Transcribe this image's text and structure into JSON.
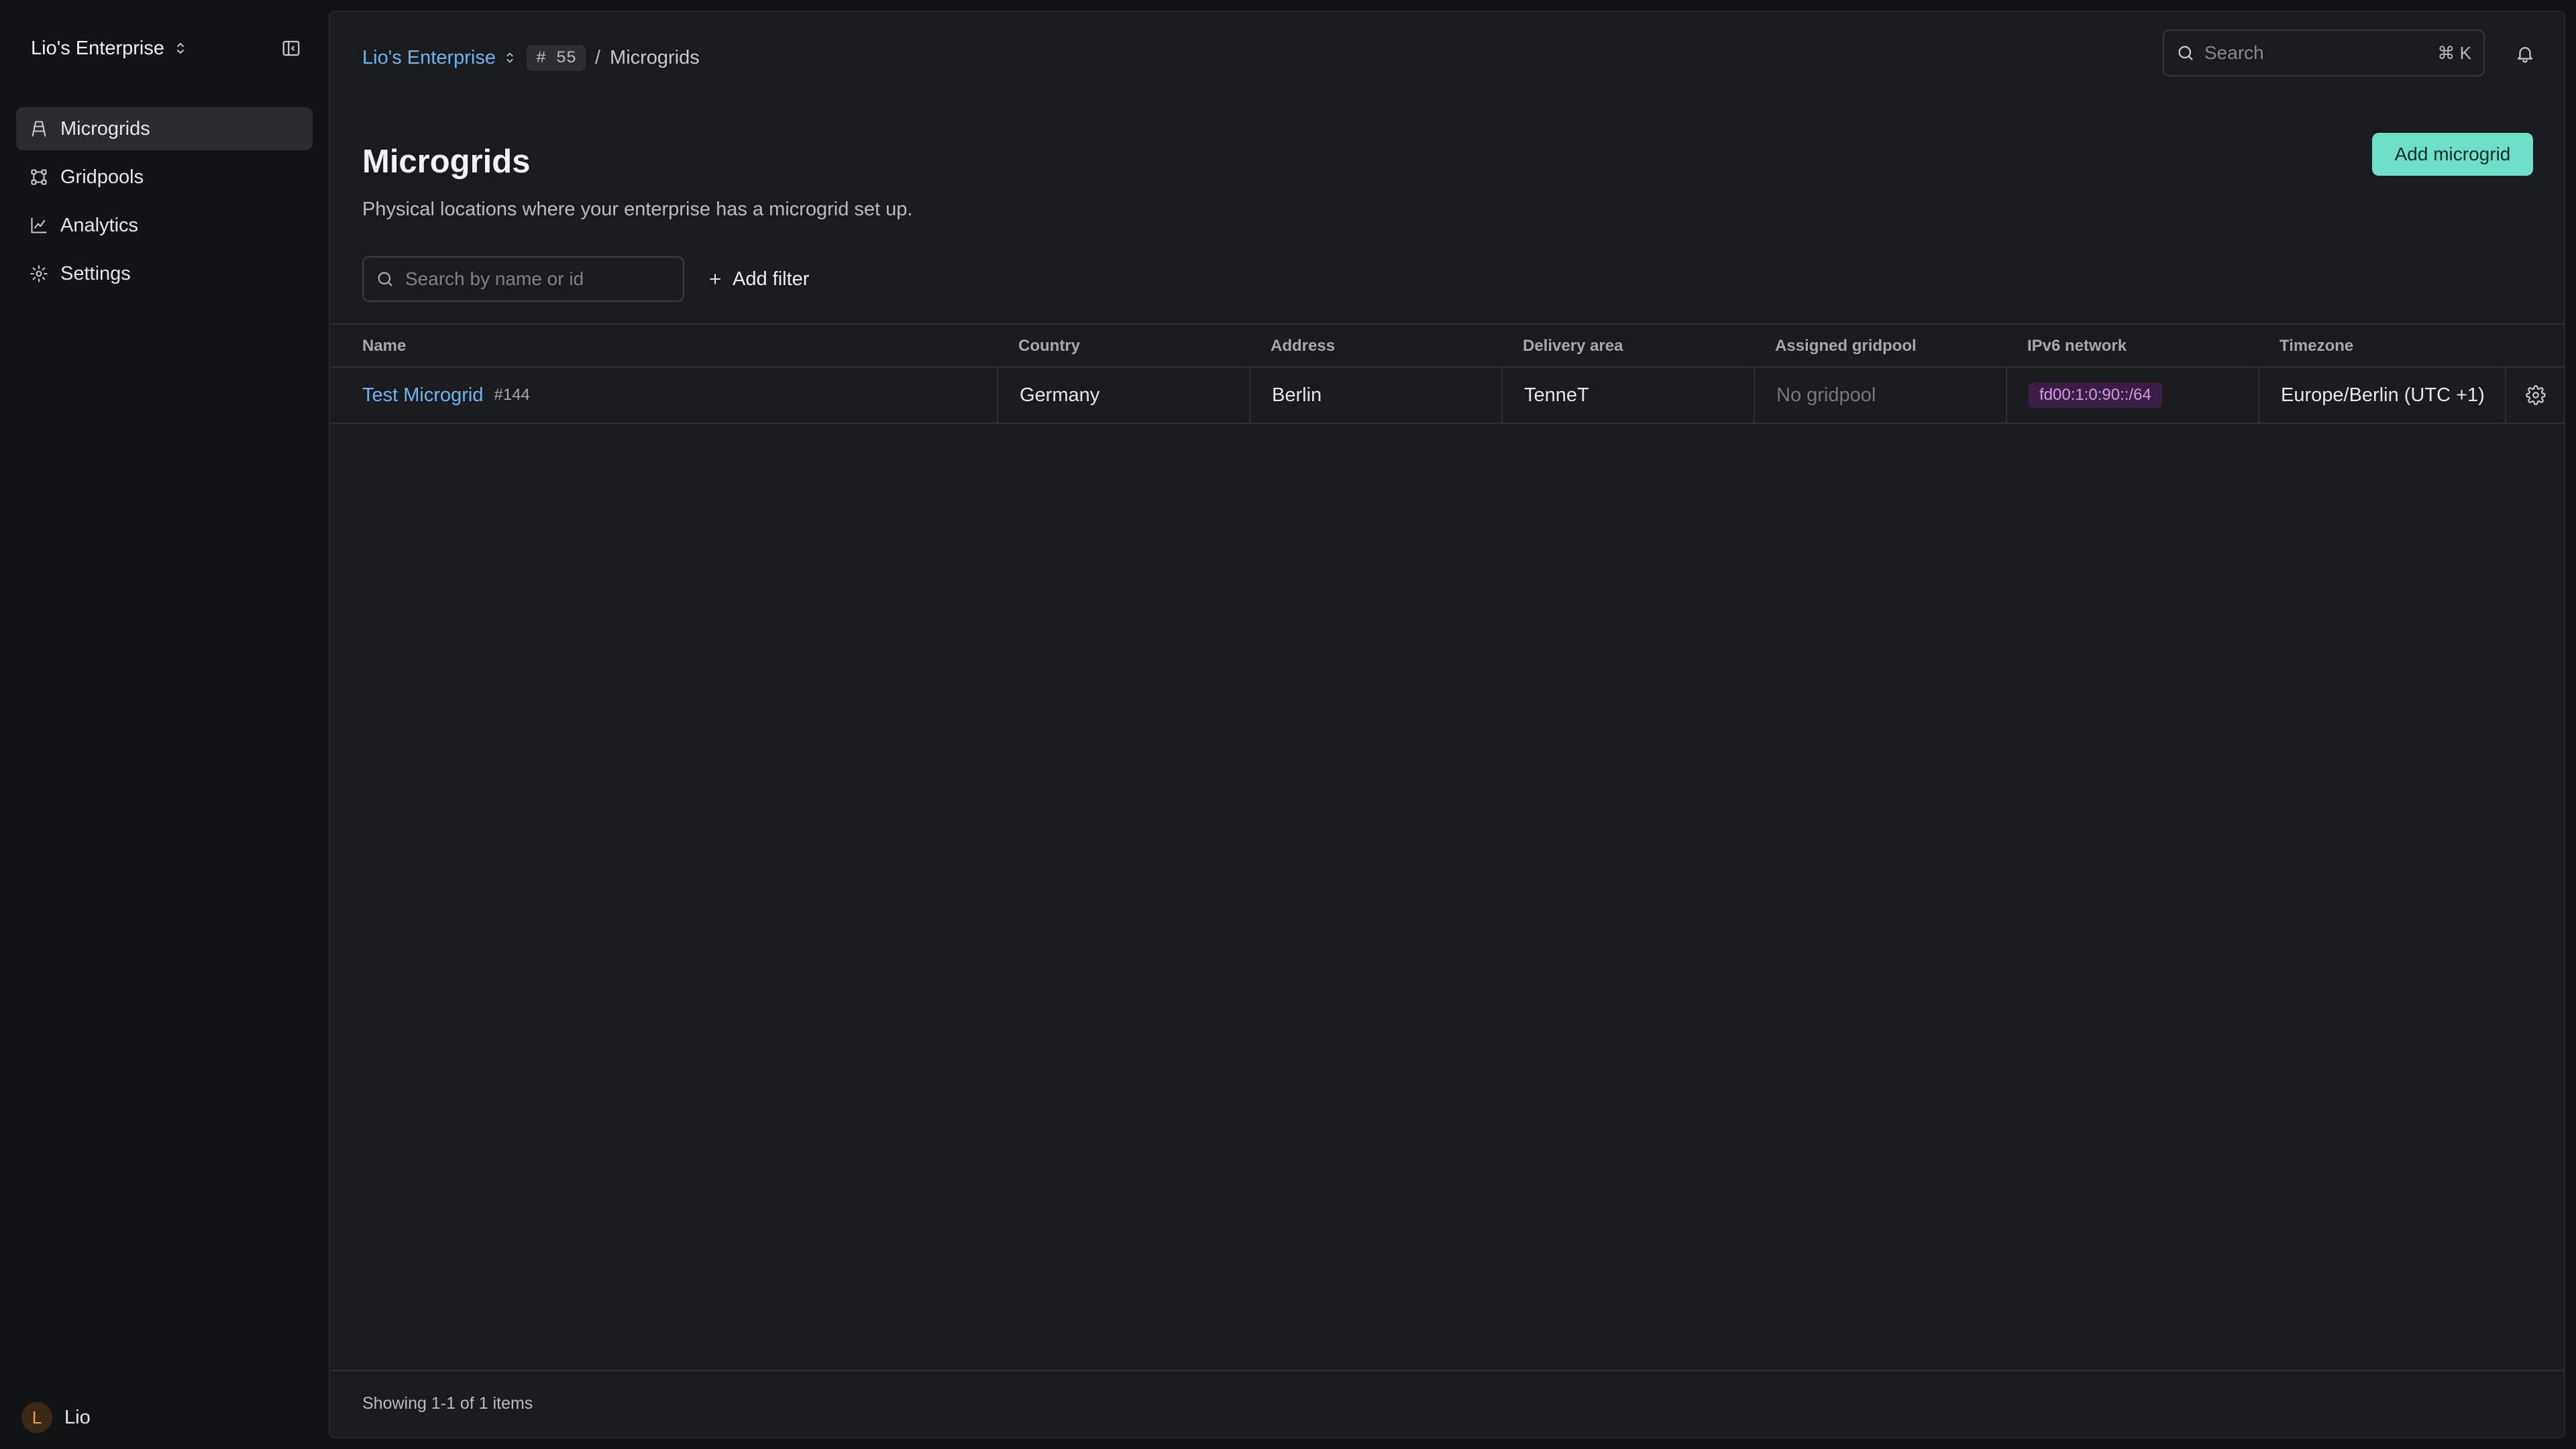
{
  "sidebar": {
    "enterprise_name": "Lio's Enterprise",
    "items": [
      {
        "label": "Microgrids",
        "icon": "microgrid-icon",
        "active": true
      },
      {
        "label": "Gridpools",
        "icon": "gridpool-icon",
        "active": false
      },
      {
        "label": "Analytics",
        "icon": "chart-icon",
        "active": false
      },
      {
        "label": "Settings",
        "icon": "gear-icon",
        "active": false
      }
    ],
    "user": {
      "initial": "L",
      "name": "Lio"
    }
  },
  "header": {
    "breadcrumb": {
      "enterprise": "Lio's Enterprise",
      "id_badge": "# 55",
      "separator": "/",
      "current": "Microgrids"
    },
    "search": {
      "placeholder": "Search",
      "shortcut": "⌘ K"
    }
  },
  "page": {
    "title": "Microgrids",
    "subtitle": "Physical locations where your enterprise has a microgrid set up.",
    "add_button": "Add microgrid",
    "filter_search_placeholder": "Search by name or id",
    "add_filter": "Add filter"
  },
  "table": {
    "columns": [
      "Name",
      "Country",
      "Address",
      "Delivery area",
      "Assigned gridpool",
      "IPv6 network",
      "Timezone"
    ],
    "rows": [
      {
        "name": "Test Microgrid",
        "id": "#144",
        "country": "Germany",
        "address": "Berlin",
        "delivery_area": "TenneT",
        "gridpool": "No gridpool",
        "ipv6": "fd00:1:0:90::/64",
        "timezone": "Europe/Berlin (UTC +1)"
      }
    ]
  },
  "footer": {
    "showing": "Showing 1-1 of 1 items"
  },
  "colors": {
    "accent": "#6ee0c8",
    "link": "#6fb3f5",
    "ipv6_badge_bg": "#3a1f45",
    "ipv6_badge_text": "#d49ae6",
    "background": "#121314",
    "panel": "#1a1b1d"
  }
}
